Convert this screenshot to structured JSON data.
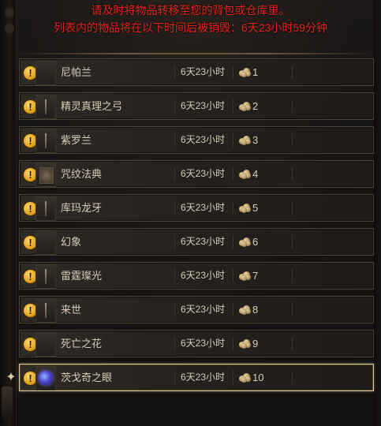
{
  "notice": {
    "line1": "请及时将物品转移至您的背包或仓库里。",
    "line2": "列表内的物品将在以下时间后被销毁：6天23小时59分钟"
  },
  "items": [
    {
      "name": "尼帕兰",
      "time": "6天23小时",
      "count": "1",
      "icon": "blank-slot-icon"
    },
    {
      "name": "精灵真理之弓",
      "time": "6天23小时",
      "count": "2",
      "icon": "bow-icon"
    },
    {
      "name": "紫罗兰",
      "time": "6天23小时",
      "count": "3",
      "icon": "staff-icon"
    },
    {
      "name": "咒纹法典",
      "time": "6天23小时",
      "count": "4",
      "icon": "tome-icon"
    },
    {
      "name": "库玛龙牙",
      "time": "6天23小时",
      "count": "5",
      "icon": "blade-icon"
    },
    {
      "name": "幻象",
      "time": "6天23小时",
      "count": "6",
      "icon": "blank-slot-icon"
    },
    {
      "name": "雷霆璨光",
      "time": "6天23小时",
      "count": "7",
      "icon": "wand-icon"
    },
    {
      "name": "来世",
      "time": "6天23小时",
      "count": "8",
      "icon": "dagger-icon"
    },
    {
      "name": "死亡之花",
      "time": "6天23小时",
      "count": "9",
      "icon": "blank-slot-icon"
    },
    {
      "name": "茨戈奇之眼",
      "time": "6天23小时",
      "count": "10",
      "icon": "orb-icon"
    }
  ],
  "selected_index": 9,
  "colors": {
    "notice": "#e8231c",
    "text": "#d7cbb7",
    "warning": "#e3a21e",
    "selected_border": "#d8c8a0"
  }
}
